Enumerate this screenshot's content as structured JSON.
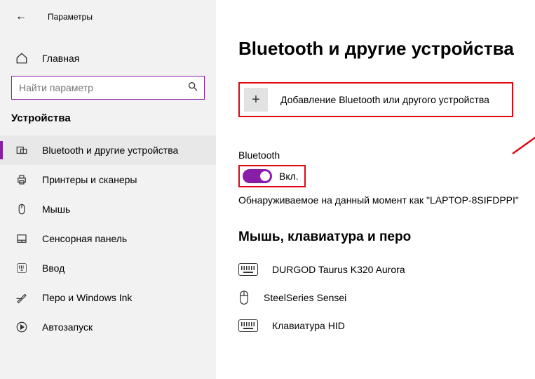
{
  "window": {
    "title": "Параметры"
  },
  "sidebar": {
    "home_label": "Главная",
    "search_placeholder": "Найти параметр",
    "section_label": "Устройства",
    "items": [
      {
        "label": "Bluetooth и другие устройства",
        "active": true
      },
      {
        "label": "Принтеры и сканеры"
      },
      {
        "label": "Мышь"
      },
      {
        "label": "Сенсорная панель"
      },
      {
        "label": "Ввод"
      },
      {
        "label": "Перо и Windows Ink"
      },
      {
        "label": "Автозапуск"
      }
    ]
  },
  "main": {
    "page_title": "Bluetooth и другие устройства",
    "add_device_label": "Добавление Bluetooth или другого устройства",
    "bt_label": "Bluetooth",
    "bt_state": "Вкл.",
    "discoverable_text": "Обнаруживаемое на данный момент как \"LAPTOP-8SIFDPPI\"",
    "devices_heading": "Мышь, клавиатура и перо",
    "devices": [
      {
        "name": "DURGOD Taurus K320 Aurora",
        "type": "keyboard"
      },
      {
        "name": "SteelSeries Sensei",
        "type": "mouse"
      },
      {
        "name": "Клавиатура HID",
        "type": "keyboard"
      }
    ]
  },
  "colors": {
    "accent": "#8a1da8",
    "highlight": "#e30613"
  }
}
